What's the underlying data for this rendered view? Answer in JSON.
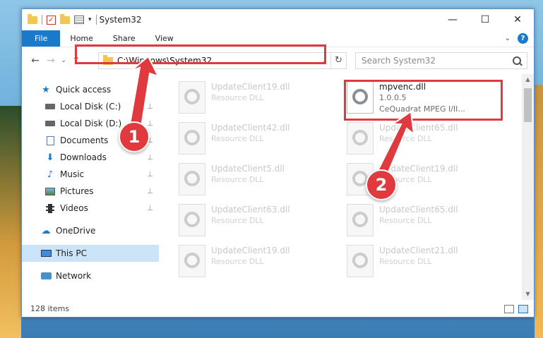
{
  "window": {
    "title": "System32",
    "controls": {
      "minimize": "—",
      "maximize": "☐",
      "close": "✕"
    }
  },
  "ribbon": {
    "tabs": [
      "File",
      "Home",
      "Share",
      "View"
    ],
    "collapse": "⌄",
    "help": "?"
  },
  "nav": {
    "back": "←",
    "forward": "→",
    "recent": "⌄",
    "up": "↑",
    "address": "C:\\Windows\\System32",
    "address_dropdown": "⌄",
    "refresh": "↻",
    "search_placeholder": "Search System32"
  },
  "sidebar": {
    "quick_access": "Quick access",
    "items": [
      {
        "label": "Local Disk (C:)",
        "pinned": true
      },
      {
        "label": "Local Disk (D:)",
        "pinned": true
      },
      {
        "label": "Documents",
        "pinned": true
      },
      {
        "label": "Downloads",
        "pinned": true
      },
      {
        "label": "Music",
        "pinned": true
      },
      {
        "label": "Pictures",
        "pinned": true
      },
      {
        "label": "Videos",
        "pinned": true
      }
    ],
    "onedrive": "OneDrive",
    "this_pc": "This PC",
    "network": "Network",
    "pin_glyph": "📌"
  },
  "files": {
    "left_column": [
      {
        "name": "UpdateClient19.dll",
        "desc": "Resource DLL"
      },
      {
        "name": "UpdateClient42.dll",
        "desc": "Resource DLL"
      },
      {
        "name": "UpdateClient5.dll",
        "desc": "Resource DLL"
      },
      {
        "name": "UpdateClient63.dll",
        "desc": "Resource DLL"
      },
      {
        "name": "UpdateClient19.dll",
        "desc": "Resource DLL"
      }
    ],
    "featured": {
      "name": "mpvenc.dll",
      "version": "1.0.0.5",
      "desc": "CeQuadrat MPEG I/II..."
    },
    "right_column": [
      {
        "name": "UpdateClient65.dll",
        "desc": "Resource DLL"
      },
      {
        "name": "UpdateClient19.dll",
        "desc": "Resource DLL"
      },
      {
        "name": "UpdateClient65.dll",
        "desc": "Resource DLL"
      },
      {
        "name": "UpdateClient21.dll",
        "desc": "Resource DLL"
      }
    ]
  },
  "status": {
    "item_count": "128 items"
  },
  "callouts": {
    "one": "1",
    "two": "2"
  },
  "colors": {
    "highlight": "#e0393e",
    "accent": "#1979ca"
  }
}
